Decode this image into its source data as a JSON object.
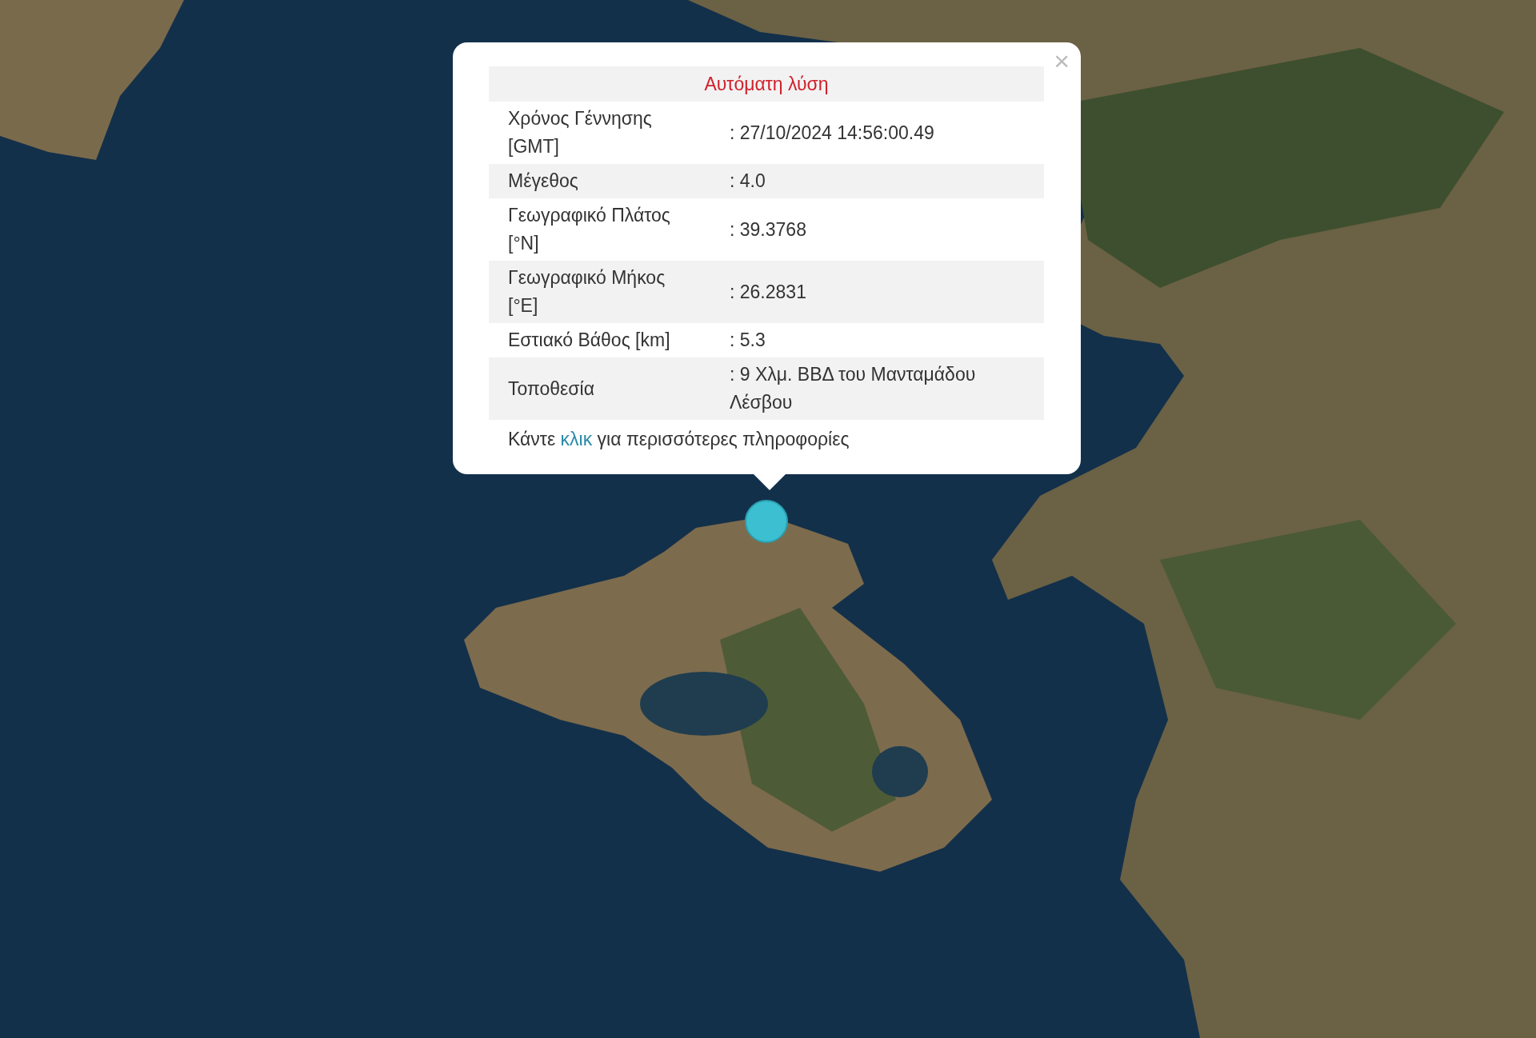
{
  "popup": {
    "close": "×",
    "title": "Αυτόματη λύση",
    "rows": [
      {
        "label": "Χρόνος Γέννησης [GMT]",
        "value": ": 27/10/2024 14:56:00.49"
      },
      {
        "label": "Μέγεθος",
        "value": ": 4.0"
      },
      {
        "label": "Γεωγραφικό Πλάτος [°N]",
        "value": ": 39.3768"
      },
      {
        "label": "Γεωγραφικό Μήκος [°E]",
        "value": ": 26.2831"
      },
      {
        "label": "Εστιακό Βάθος [km]",
        "value": ": 5.3"
      },
      {
        "label": "Τοποθεσία",
        "value": ": 9 Χλμ. ΒΒΔ του Μανταμάδου Λέσβου"
      }
    ],
    "footer": {
      "before": "Κάντε",
      "link": "κλικ",
      "after": "για περισσότερες πληροφορίες"
    }
  }
}
